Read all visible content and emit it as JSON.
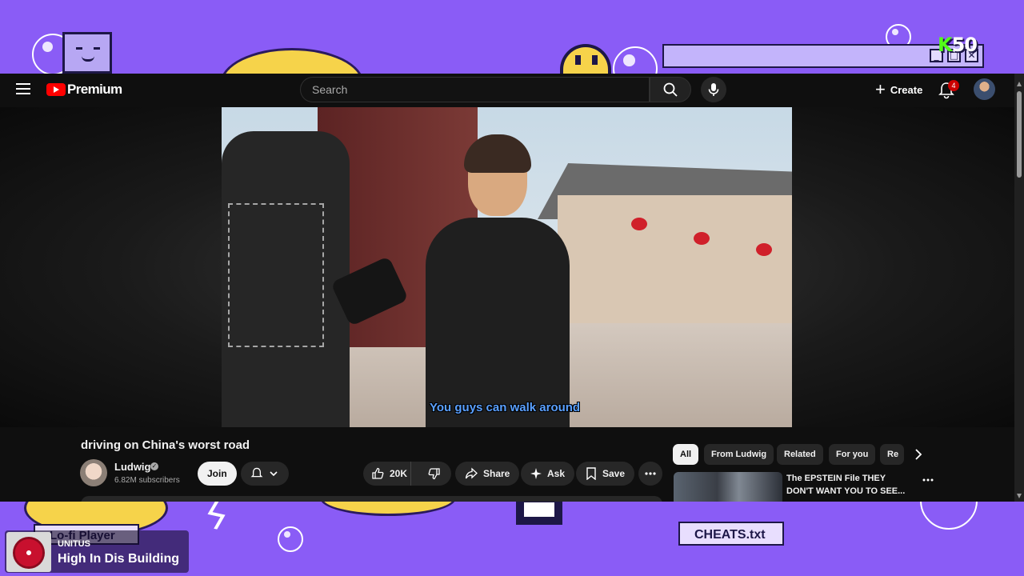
{
  "colors": {
    "overlay_bg": "#8a5cf6",
    "accent_yellow": "#f6d34a",
    "youtube_red": "#ff0000",
    "subtitle_blue": "#5aa0ff",
    "kick_green": "#53fc18"
  },
  "overlay": {
    "k50_prefix": "K",
    "k50_suffix": "50",
    "lofi_label": "Lo-fi Player",
    "cheats_label": "CHEATS.txt",
    "now_playing": {
      "artist": "UNITUS",
      "track": "High In Dis Building"
    },
    "window_controls": [
      "_",
      "□",
      "✕"
    ]
  },
  "youtube": {
    "brand": "Premium",
    "search_placeholder": "Search",
    "create_label": "Create",
    "notification_count": "4",
    "icons": {
      "menu": "hamburger-menu-icon",
      "search": "search-icon",
      "mic": "microphone-icon",
      "create": "plus-icon",
      "bell": "bell-icon"
    },
    "video": {
      "subtitle": "You guys can walk around",
      "title": "driving on China's worst road"
    },
    "channel": {
      "name": "Ludwig",
      "verified_mark": "✓",
      "subscribers": "6.82M subscribers",
      "join_label": "Join"
    },
    "actions": {
      "like_count": "20K",
      "share_label": "Share",
      "ask_label": "Ask",
      "save_label": "Save"
    },
    "chips": [
      "All",
      "From Ludwig",
      "Related",
      "For you",
      "Re"
    ],
    "recommendation": {
      "title": "The EPSTEIN File THEY DON'T WANT YOU TO SEE..."
    }
  }
}
